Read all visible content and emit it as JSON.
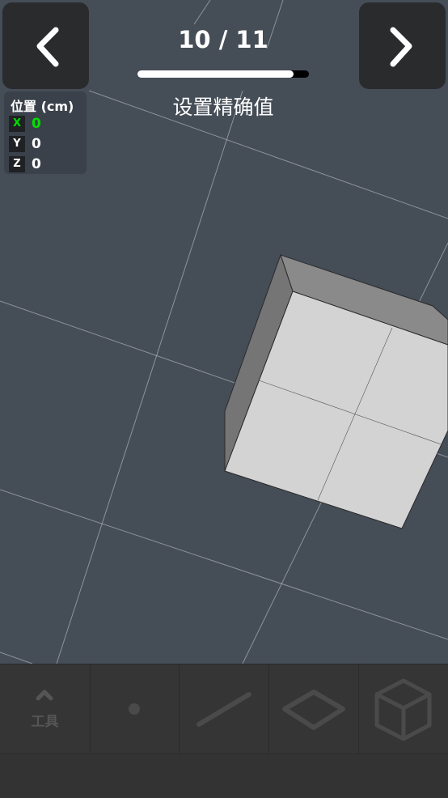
{
  "navigation": {
    "prev_icon": "chevron-left-icon",
    "next_icon": "chevron-right-icon",
    "step_counter": "10 / 11",
    "progress": 0.91,
    "step_title": "设置精确值"
  },
  "position_panel": {
    "title": "位置 (cm)",
    "x": {
      "label": "X",
      "value": "0",
      "color": "#00e000"
    },
    "y": {
      "label": "Y",
      "value": "0",
      "color": "#ffffff"
    },
    "z": {
      "label": "Z",
      "value": "0",
      "color": "#ffffff"
    }
  },
  "toolbar": {
    "menu": {
      "icon": "chevron-up-icon",
      "label": "工具"
    },
    "tools": [
      {
        "name": "point",
        "icon": "point-icon"
      },
      {
        "name": "line",
        "icon": "line-icon"
      },
      {
        "name": "plane",
        "icon": "plane-icon"
      },
      {
        "name": "cube",
        "icon": "cube-icon"
      }
    ]
  },
  "colors": {
    "background": "#454d57",
    "button": "#2a2b2d",
    "toolbar": "#353535",
    "tool_icon": "#4a4a4a"
  }
}
